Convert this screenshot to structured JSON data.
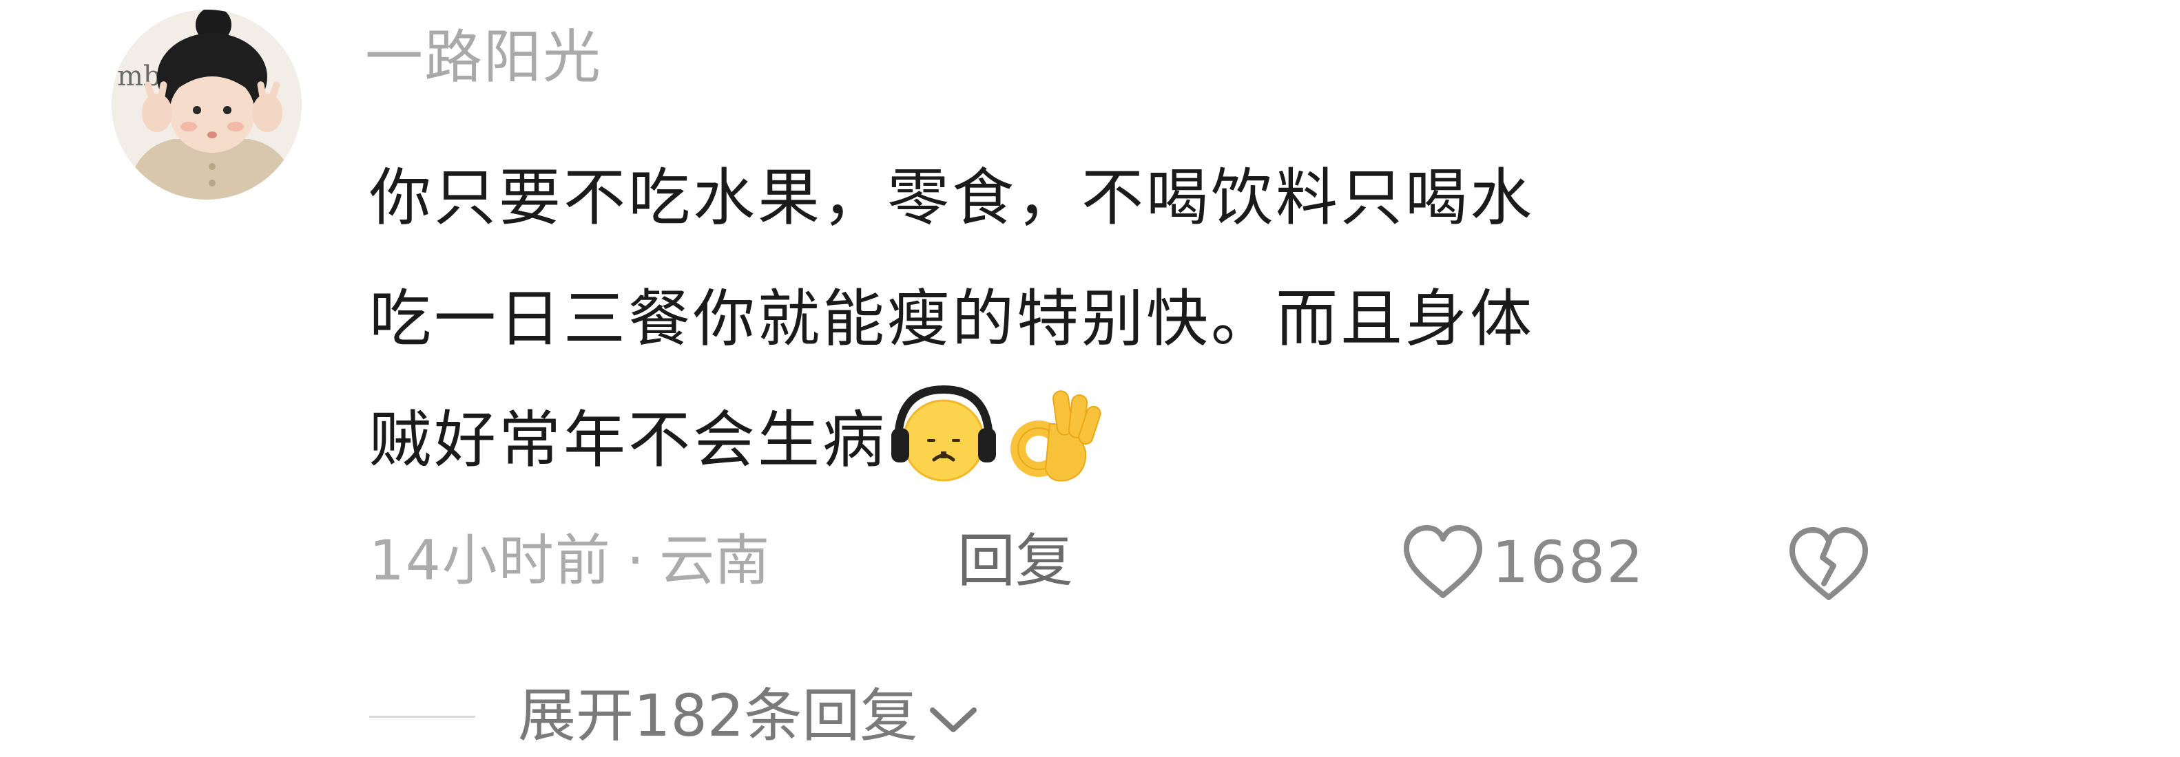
{
  "comment": {
    "username": "一路阳光",
    "avatar_text": "mb",
    "content_lines": [
      "你只要不吃水果，零食，不喝饮料只喝水",
      "吃一日三餐你就能瘦的特别快。而且身体",
      "贼好常年不会生病"
    ],
    "emojis": [
      "headphones-face-emoji",
      "ok-hand-emoji"
    ],
    "time": "14小时前",
    "separator": "·",
    "location": "云南",
    "reply_label": "回复",
    "like_icon": "heart-outline-icon",
    "like_count": "1682",
    "dislike_icon": "broken-heart-icon",
    "expand_label": "展开182条回复",
    "expand_icon": "chevron-down-icon"
  },
  "colors": {
    "background": "#ffffff",
    "username": "#a9a9a9",
    "content": "#1a1a1a",
    "meta": "#ababab",
    "reply": "#6a6a6a",
    "count": "#8a8a8a"
  }
}
